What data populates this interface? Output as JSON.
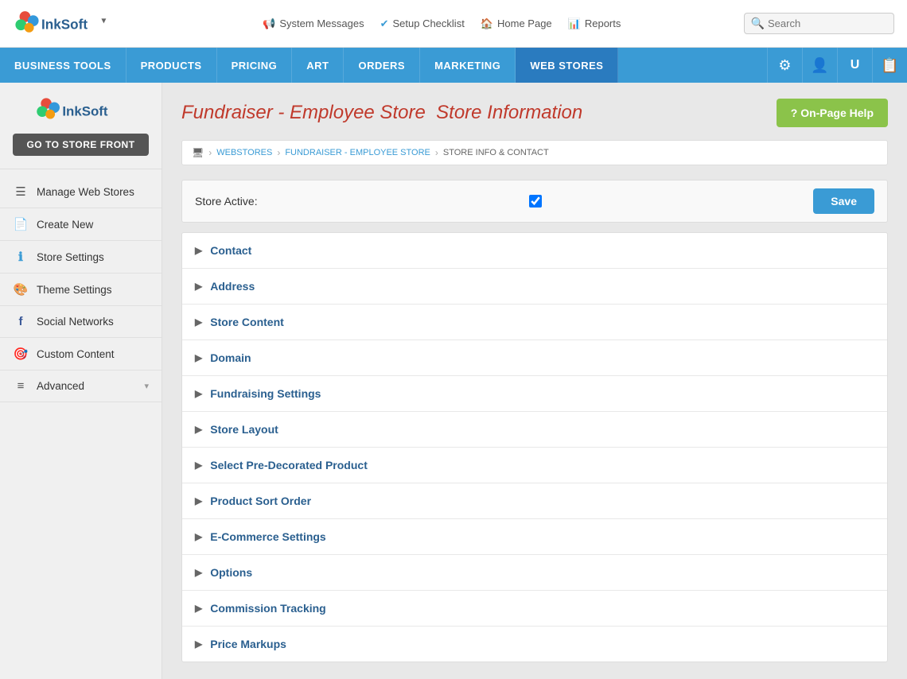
{
  "topbar": {
    "links": [
      {
        "id": "system-messages",
        "icon": "megaphone",
        "label": "System Messages"
      },
      {
        "id": "setup-checklist",
        "icon": "check",
        "label": "Setup Checklist"
      },
      {
        "id": "home-page",
        "icon": "home",
        "label": "Home Page"
      },
      {
        "id": "reports",
        "icon": "chart",
        "label": "Reports"
      }
    ],
    "search_placeholder": "Search"
  },
  "navbar": {
    "items": [
      {
        "id": "business-tools",
        "label": "Business Tools",
        "active": false
      },
      {
        "id": "products",
        "label": "Products",
        "active": false
      },
      {
        "id": "pricing",
        "label": "Pricing",
        "active": false
      },
      {
        "id": "art",
        "label": "Art",
        "active": false
      },
      {
        "id": "orders",
        "label": "Orders",
        "active": false
      },
      {
        "id": "marketing",
        "label": "Marketing",
        "active": false
      },
      {
        "id": "web-stores",
        "label": "Web Stores",
        "active": true
      }
    ],
    "icons": [
      {
        "id": "settings-icon",
        "symbol": "⚙"
      },
      {
        "id": "user-icon",
        "symbol": "👤"
      },
      {
        "id": "tag-icon",
        "symbol": "U"
      },
      {
        "id": "clipboard-icon",
        "symbol": "📋"
      }
    ]
  },
  "sidebar": {
    "logo_text": "InkSoft",
    "go_to_store_label": "GO TO STORE FRONT",
    "items": [
      {
        "id": "manage-web-stores",
        "label": "Manage Web Stores",
        "icon": "list"
      },
      {
        "id": "create-new",
        "label": "Create New",
        "icon": "file"
      },
      {
        "id": "store-settings",
        "label": "Store Settings",
        "icon": "info"
      },
      {
        "id": "theme-settings",
        "label": "Theme Settings",
        "icon": "theme"
      },
      {
        "id": "social-networks",
        "label": "Social Networks",
        "icon": "social"
      },
      {
        "id": "custom-content",
        "label": "Custom Content",
        "icon": "content"
      },
      {
        "id": "advanced",
        "label": "Advanced",
        "icon": "menu",
        "has_arrow": true
      }
    ]
  },
  "content": {
    "page_title_main": "Fundraiser - Employee Store",
    "page_title_highlight": "Store Information",
    "help_button_label": "? On-Page Help",
    "breadcrumb": {
      "home_icon": "🖥",
      "items": [
        {
          "id": "webstores",
          "label": "WEBSTORES"
        },
        {
          "id": "fundraiser-employee",
          "label": "FUNDRAISER - EMPLOYEE STORE"
        },
        {
          "id": "store-info",
          "label": "STORE INFO & CONTACT"
        }
      ]
    },
    "store_active_label": "Store Active:",
    "store_active_checked": true,
    "save_label": "Save",
    "accordion_items": [
      {
        "id": "contact",
        "label": "Contact"
      },
      {
        "id": "address",
        "label": "Address"
      },
      {
        "id": "store-content",
        "label": "Store Content"
      },
      {
        "id": "domain",
        "label": "Domain"
      },
      {
        "id": "fundraising-settings",
        "label": "Fundraising Settings"
      },
      {
        "id": "store-layout",
        "label": "Store Layout"
      },
      {
        "id": "select-pre-decorated",
        "label": "Select Pre-Decorated Product"
      },
      {
        "id": "product-sort-order",
        "label": "Product Sort Order"
      },
      {
        "id": "ecommerce-settings",
        "label": "E-Commerce Settings"
      },
      {
        "id": "options",
        "label": "Options"
      },
      {
        "id": "commission-tracking",
        "label": "Commission Tracking"
      },
      {
        "id": "price-markups",
        "label": "Price Markups"
      }
    ]
  }
}
